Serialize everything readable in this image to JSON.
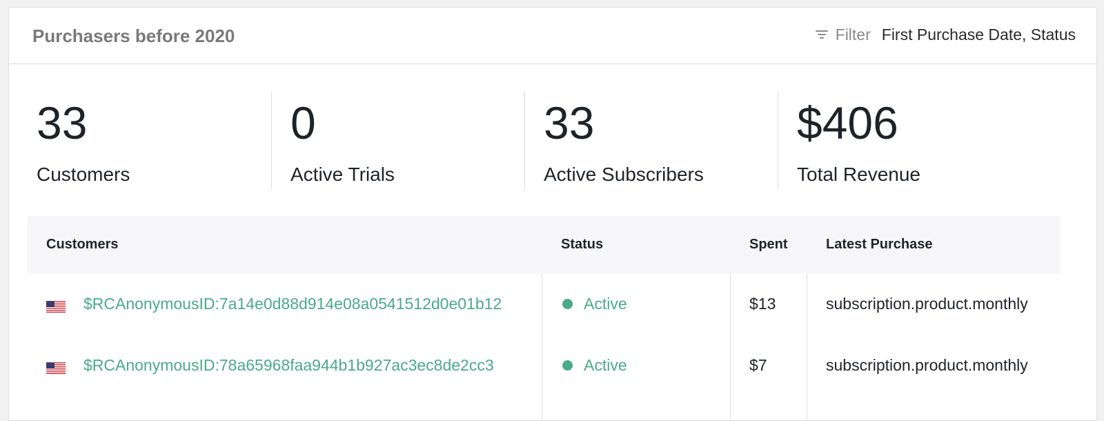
{
  "header": {
    "title": "Purchasers before 2020",
    "filter_label": "Filter",
    "filter_value": "First Purchase Date, Status",
    "filter_icon": "filter-icon"
  },
  "stats": [
    {
      "value": "33",
      "label": "Customers"
    },
    {
      "value": "0",
      "label": "Active Trials"
    },
    {
      "value": "33",
      "label": "Active Subscribers"
    },
    {
      "value": "$406",
      "label": "Total Revenue"
    }
  ],
  "table": {
    "columns": [
      "Customers",
      "Status",
      "Spent",
      "Latest Purchase"
    ],
    "rows": [
      {
        "flag": "us-flag-icon",
        "customer": "$RCAnonymousID:7a14e0d88d914e08a0541512d0e01b12",
        "status": "Active",
        "spent": "$13",
        "latest_purchase": "subscription.product.monthly"
      },
      {
        "flag": "us-flag-icon",
        "customer": "$RCAnonymousID:78a65968faa944b1b927ac3ec8de2cc3",
        "status": "Active",
        "spent": "$7",
        "latest_purchase": "subscription.product.monthly"
      }
    ]
  },
  "colors": {
    "accent": "#4aaa8b",
    "status_active": "#4aaa8b",
    "border": "#dcdde0",
    "header_bg": "#f6f6f8"
  }
}
